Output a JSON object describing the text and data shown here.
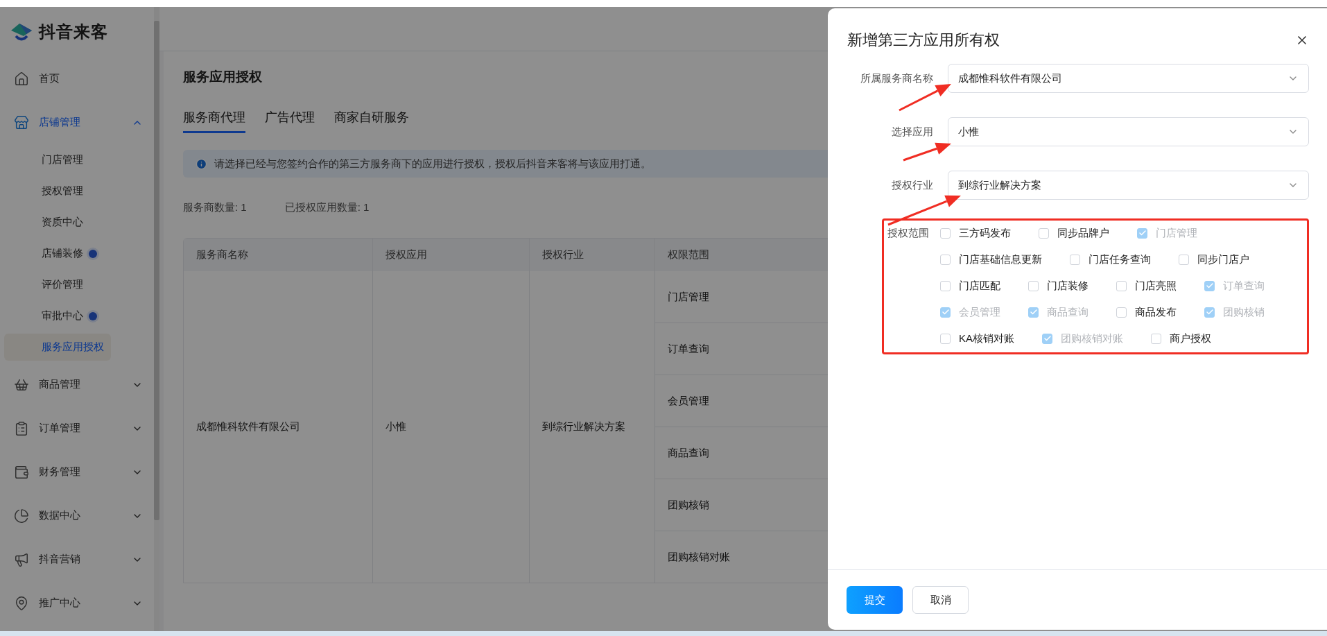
{
  "sidebar": {
    "logo": "抖音来客",
    "items": [
      {
        "label": "首页",
        "selected": false
      },
      {
        "label": "店铺管理",
        "expanded": true,
        "selected": true,
        "children": [
          {
            "label": "门店管理",
            "selected": false,
            "has_notice": false
          },
          {
            "label": "授权管理",
            "selected": false,
            "has_notice": false
          },
          {
            "label": "资质中心",
            "selected": false,
            "has_notice": false
          },
          {
            "label": "店铺装修",
            "selected": false,
            "has_notice": true
          },
          {
            "label": "评价管理",
            "selected": false,
            "has_notice": false
          },
          {
            "label": "审批中心",
            "selected": false,
            "has_notice": true
          },
          {
            "label": "服务应用授权",
            "selected": true,
            "has_notice": false
          }
        ]
      },
      {
        "label": "商品管理",
        "expanded": false,
        "selected": false
      },
      {
        "label": "订单管理",
        "expanded": false,
        "selected": false
      },
      {
        "label": "财务管理",
        "expanded": false,
        "selected": false
      },
      {
        "label": "数据中心",
        "expanded": false,
        "selected": false
      },
      {
        "label": "抖音营销",
        "expanded": false,
        "selected": false
      },
      {
        "label": "推广中心",
        "expanded": false,
        "selected": false
      }
    ]
  },
  "page": {
    "title": "服务应用授权",
    "tabs": [
      {
        "label": "服务商代理",
        "selected": true
      },
      {
        "label": "广告代理",
        "selected": false
      },
      {
        "label": "商家自研服务",
        "selected": false
      }
    ],
    "notice": "请选择已经与您签约合作的第三方服务商下的应用进行授权，授权后抖音来客将与该应用打通。",
    "stats": [
      "服务商数量: 1",
      "已授权应用数量: 1"
    ],
    "table": {
      "columns": [
        "服务商名称",
        "授权应用",
        "授权行业",
        "权限范围"
      ],
      "rows": [
        {
          "provider": "成都惟科软件有限公司",
          "app": "小惟",
          "industry": "到综行业解决方案",
          "scopes": [
            "门店管理",
            "订单查询",
            "会员管理",
            "商品查询",
            "团购核销",
            "团购核销对账"
          ]
        }
      ]
    }
  },
  "drawer": {
    "title": "新增第三方应用所有权",
    "fields": [
      {
        "label": "所属服务商名称",
        "value": "成都惟科软件有限公司"
      },
      {
        "label": "选择应用",
        "value": "小惟"
      },
      {
        "label": "授权行业",
        "value": "到综行业解决方案"
      }
    ],
    "scope": {
      "label": "授权范围",
      "options": [
        {
          "label": "三方码发布",
          "checked": false
        },
        {
          "label": "同步品牌户",
          "checked": false
        },
        {
          "label": "门店管理",
          "checked": true
        },
        {
          "label": "门店基础信息更新",
          "checked": false
        },
        {
          "label": "门店任务查询",
          "checked": false
        },
        {
          "label": "同步门店户",
          "checked": false
        },
        {
          "label": "门店匹配",
          "checked": false
        },
        {
          "label": "门店装修",
          "checked": false
        },
        {
          "label": "门店亮照",
          "checked": false
        },
        {
          "label": "订单查询",
          "checked": true
        },
        {
          "label": "会员管理",
          "checked": true
        },
        {
          "label": "商品查询",
          "checked": true
        },
        {
          "label": "商品发布",
          "checked": false
        },
        {
          "label": "团购核销",
          "checked": true
        },
        {
          "label": "KA核销对账",
          "checked": false
        },
        {
          "label": "团购核销对账",
          "checked": true
        },
        {
          "label": "商户授权",
          "checked": false
        }
      ]
    },
    "buttons": [
      {
        "label": "提交",
        "kind": "primary"
      },
      {
        "label": "取消",
        "kind": "default"
      }
    ]
  }
}
